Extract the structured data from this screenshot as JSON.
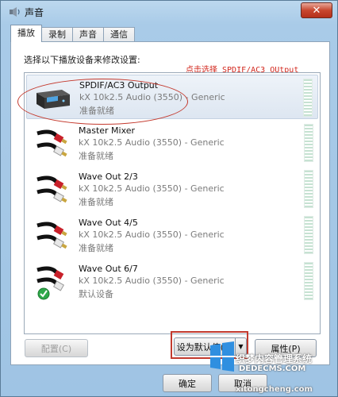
{
  "window": {
    "title": "声音",
    "close_label": "✕"
  },
  "tabs": [
    {
      "label": "播放",
      "active": true
    },
    {
      "label": "录制",
      "active": false
    },
    {
      "label": "声音",
      "active": false
    },
    {
      "label": "通信",
      "active": false
    }
  ],
  "instruction": "选择以下播放设备来修改设置:",
  "annotation": "点击选择 SPDIF/AC3 OUtput",
  "devices": [
    {
      "name": "SPDIF/AC3 Output",
      "driver": "kX 10k2.5 Audio (3550) - Generic",
      "status": "准备就绪",
      "icon": "spdif-device-icon",
      "selected": true
    },
    {
      "name": "Master Mixer",
      "driver": "kX 10k2.5 Audio (3550) - Generic",
      "status": "准备就绪",
      "icon": "rca-cable-icon",
      "selected": false
    },
    {
      "name": "Wave Out 2/3",
      "driver": "kX 10k2.5 Audio (3550) - Generic",
      "status": "准备就绪",
      "icon": "rca-cable-icon",
      "selected": false
    },
    {
      "name": "Wave Out 4/5",
      "driver": "kX 10k2.5 Audio (3550) - Generic",
      "status": "准备就绪",
      "icon": "rca-cable-icon",
      "selected": false
    },
    {
      "name": "Wave Out 6/7",
      "driver": "kX 10k2.5 Audio (3550) - Generic",
      "status": "默认设备",
      "icon": "rca-cable-default-icon",
      "selected": false
    }
  ],
  "buttons": {
    "configure": "配置(C)",
    "set_default": "设为默认值(S)",
    "properties": "属性(P)",
    "ok": "确定",
    "cancel": "取消"
  },
  "watermark": {
    "line1": "织梦内容管理系统",
    "line2": "DEDECMS.COM",
    "line3": "xitongcheng.com"
  },
  "colors": {
    "annotation": "#d2281e",
    "highlight_border": "#c23a2e",
    "window_frame": "#a9cbe8"
  }
}
